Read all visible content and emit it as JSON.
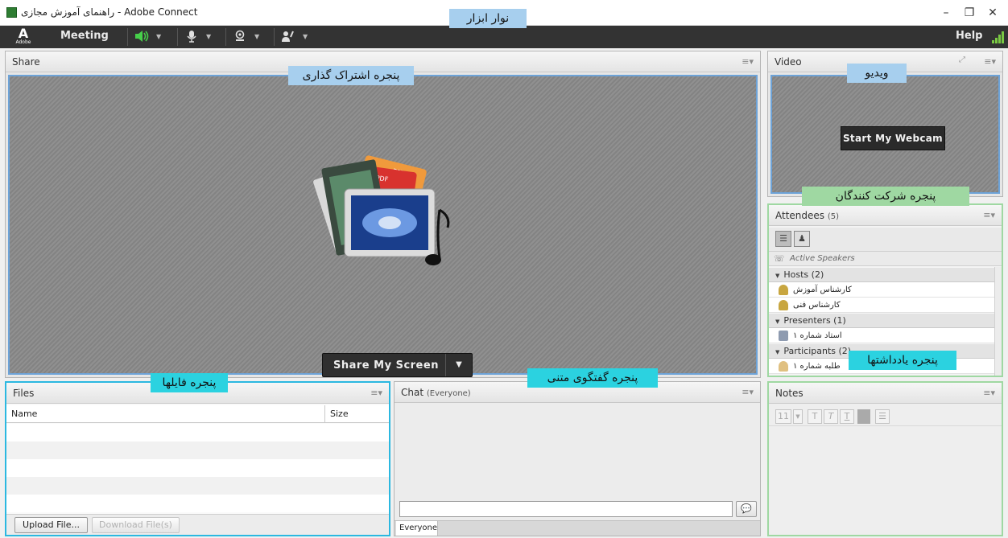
{
  "window": {
    "title": "راهنمای آموزش مجازی - Adobe Connect",
    "controls": [
      "–",
      "❐",
      "✕"
    ]
  },
  "menubar": {
    "logo": "A",
    "logo_sub": "Adobe",
    "meeting": "Meeting",
    "help": "Help",
    "tools": [
      "speaker-icon",
      "microphone-icon",
      "webcam-icon",
      "raise-hand-icon"
    ],
    "speaker_color": "#46d04a",
    "signal_color": "#7ac943"
  },
  "share": {
    "title": "Share",
    "button_label": "Share My Screen",
    "doc_labels": [
      "PPT",
      "PDF"
    ],
    "illustration": "share-content-icon"
  },
  "video": {
    "title": "Video",
    "button_label": "Start My Webcam"
  },
  "attendees": {
    "title": "Attendees",
    "count": "(5)",
    "active_speakers": "Active Speakers",
    "groups": [
      {
        "label": "Hosts (2)",
        "members": [
          "کارشناس آموزش",
          "کارشناس فنی"
        ]
      },
      {
        "label": "Presenters (1)",
        "members": [
          "استاد شماره ۱"
        ]
      },
      {
        "label": "Participants (2)",
        "members": [
          "طلبه شماره ۱"
        ]
      }
    ]
  },
  "files": {
    "title": "Files",
    "col_name": "Name",
    "col_size": "Size",
    "upload": "Upload File...",
    "download": "Download File(s)"
  },
  "chat": {
    "title": "Chat",
    "scope": "(Everyone)",
    "tab": "Everyone"
  },
  "notes": {
    "title": "Notes",
    "font_size": "11"
  },
  "annotations": {
    "toolbar": "نوار ابزار",
    "share": "پنجره اشتراک گذاری",
    "video": "ویدیو",
    "attendees": "پنجره شرکت کنندگان",
    "files": "پنجره فایلها",
    "chat": "پنجره گفتگوی متنی",
    "notes": "پنجره یادداشتها"
  },
  "colors": {
    "annotation_blue": "#a7cfee",
    "annotation_cyan": "#2bd2e0",
    "annotation_green": "#9fd8a2",
    "menubar": "#333333"
  }
}
